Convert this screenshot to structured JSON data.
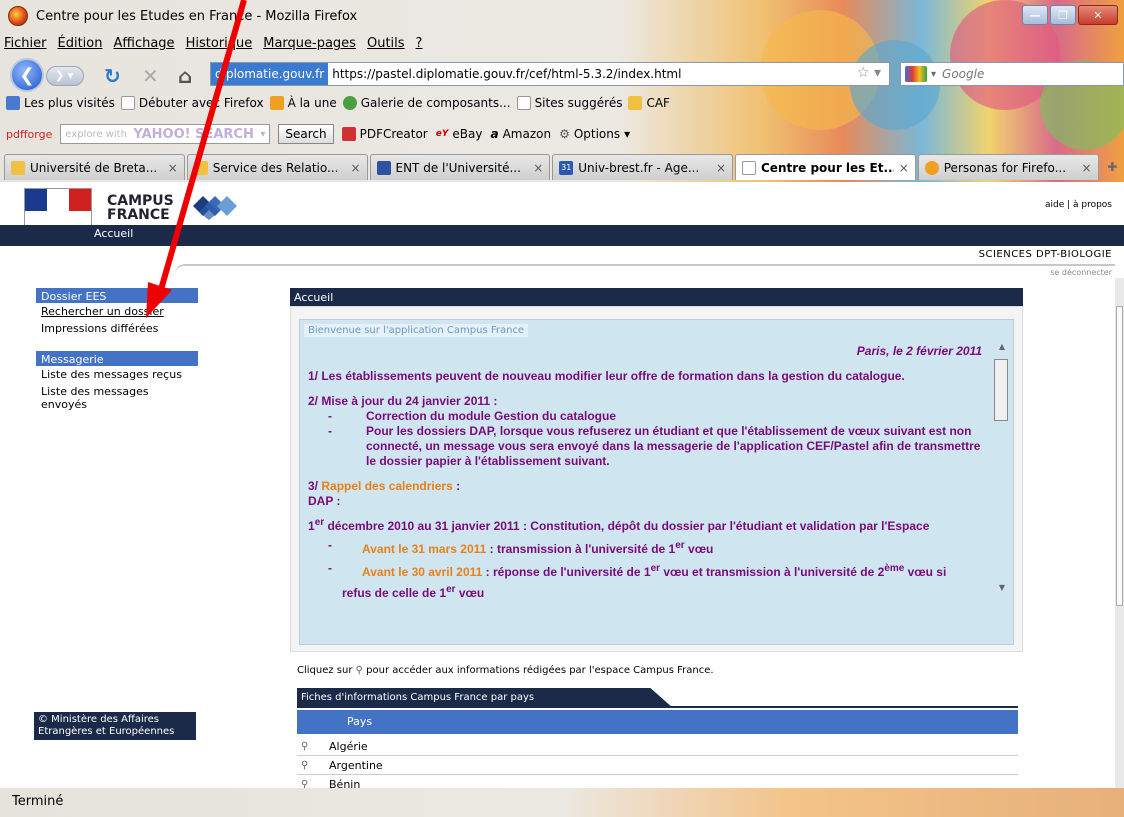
{
  "window": {
    "title": "Centre pour les Etudes en France - Mozilla Firefox"
  },
  "menu": [
    "Fichier",
    "Édition",
    "Affichage",
    "Historique",
    "Marque-pages",
    "Outils",
    "?"
  ],
  "nav": {
    "site_badge": "diplomatie.gouv.fr",
    "url": "https://pastel.diplomatie.gouv.fr/cef/html-5.3.2/index.html",
    "search_placeholder": "Google"
  },
  "bookmarks": [
    "Les plus visités",
    "Débuter avec Firefox",
    "À la une",
    "Galerie de composants...",
    "Sites suggérés",
    "CAF"
  ],
  "toolbar": {
    "pdfforge": "pdfforge",
    "yahoo_placeholder": "explore with",
    "yahoo_brand": "YAHOO! SEARCH",
    "search_button": "Search",
    "pdfcreator": "PDFCreator",
    "ebay": "eBay",
    "amazon": "Amazon",
    "options": "Options"
  },
  "tabs": [
    {
      "label": "Université de Breta..."
    },
    {
      "label": "Service des Relatio..."
    },
    {
      "label": "ENT de l'Université..."
    },
    {
      "label": "Univ-brest.fr - Age..."
    },
    {
      "label": "Centre pour les Et..."
    },
    {
      "label": "Personas for Firefo..."
    }
  ],
  "tab_close": "×",
  "calendar_badge": "31",
  "header": {
    "campus_line1": "CAMPUS",
    "campus_line2": "FRANCE",
    "links": "aide   |  à propos",
    "nav_tab": "Accueil",
    "user_label": "SCIENCES DPT-BIOLOGIE",
    "logout": "se déconnecter"
  },
  "leftnav": {
    "section1": "Dossier EES",
    "item1": "Rechercher un dossier",
    "item2": "Impressions différées",
    "section2": "Messagerie",
    "item3": "Liste des messages reçus",
    "item4": "Liste des messages envoyés",
    "footer1": "© Ministère des Affaires",
    "footer2": "Etrangères et Européennes"
  },
  "main": {
    "title": "Accueil",
    "welcome": "Bienvenue sur l'application Campus France",
    "date": "Paris, le 2 février  2011",
    "p1": "1/ Les établissements peuvent de nouveau modifier leur offre de formation dans la gestion du catalogue.",
    "p2_title": "2/ Mise à jour du 24 janvier 2011 :",
    "p2_b1": "Correction du module Gestion du catalogue",
    "p2_b2": "Pour les dossiers DAP, lorsque vous refuserez un étudiant et que l'établissement de vœux suivant est non connecté, un message vous sera envoyé dans la messagerie de l'application CEF/Pastel afin de transmettre le dossier papier à l'établissement suivant.",
    "p3_num": "3/",
    "p3_title": "Rappel des calendriers",
    "p3_colon": " :",
    "dap": "DAP :",
    "line1_a": "1",
    "line1_sup": "er",
    "line1_b": " décembre 2010 au 31 janvier 2011 : Constitution, dépôt du dossier par l'étudiant et validation par l'Espace",
    "b1_orange": "Avant le 31 mars 2011",
    "b1_rest": " : transmission à l'université de 1",
    "b1_sup": "er",
    "b1_end": " vœu",
    "b2_orange": "Avant le 30 avril 2011",
    "b2_rest": " : réponse de l'université de 1",
    "b2_sup": "er",
    "b2_mid": " vœu et transmission à l'université de 2",
    "b2_sup2": "ème",
    "b2_end": " vœu si",
    "b2_line2": "refus de celle de 1",
    "b2_sup3": "er",
    "b2_line2_end": " vœu"
  },
  "cliquez": {
    "before": "Cliquez sur",
    "after": "pour accéder aux informations rédigées par l'espace Campus France."
  },
  "fiches": {
    "tab": "Fiches d'informations Campus France par pays",
    "column": "Pays",
    "rows": [
      "Algérie",
      "Argentine",
      "Bénin"
    ]
  },
  "status": "Terminé"
}
